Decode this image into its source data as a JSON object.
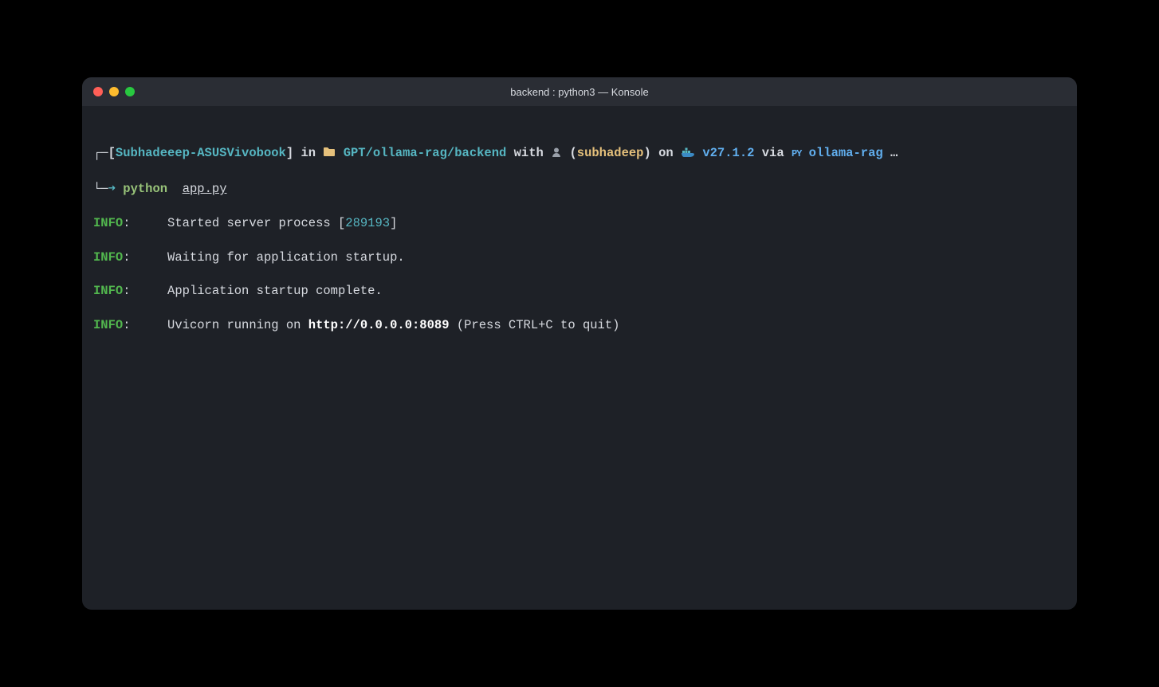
{
  "window": {
    "title": "backend : python3 — Konsole"
  },
  "prompt": {
    "corner_top": "┌─",
    "corner_bottom": "└─",
    "bracket_open": "[",
    "host": "Subhadeeep-ASUSVivobook",
    "bracket_close": "]",
    "in_label": " in ",
    "folder_icon": "📁",
    "path": " GPT/ollama-rag/backend",
    "with_label": " with ",
    "user_icon": "👤",
    "paren_open": "(",
    "user": "subhadeep",
    "paren_close": ")",
    "on_label": " on ",
    "docker_icon": "🐳",
    "docker_version": " v27.1.2",
    "via_label": " via ",
    "py_icon": "🐍",
    "venv": " ollama-rag",
    "ellipsis": " …",
    "arrow": "➜",
    "cmd_name": "python",
    "cmd_arg": "app.py"
  },
  "log": {
    "info_label": "INFO",
    "colon": ":",
    "lines": [
      {
        "pre": "     Started server process [",
        "highlight": "289193",
        "post": "]"
      },
      {
        "pre": "     Waiting for application startup.",
        "highlight": "",
        "post": ""
      },
      {
        "pre": "     Application startup complete.",
        "highlight": "",
        "post": ""
      },
      {
        "pre": "     Uvicorn running on ",
        "bold": "http://0.0.0.0:8089",
        "post": " (Press CTRL+C to quit)"
      }
    ]
  },
  "icons": {
    "folder": "folder-icon",
    "user": "user-icon",
    "docker": "whale-icon",
    "python": "python-icon"
  }
}
